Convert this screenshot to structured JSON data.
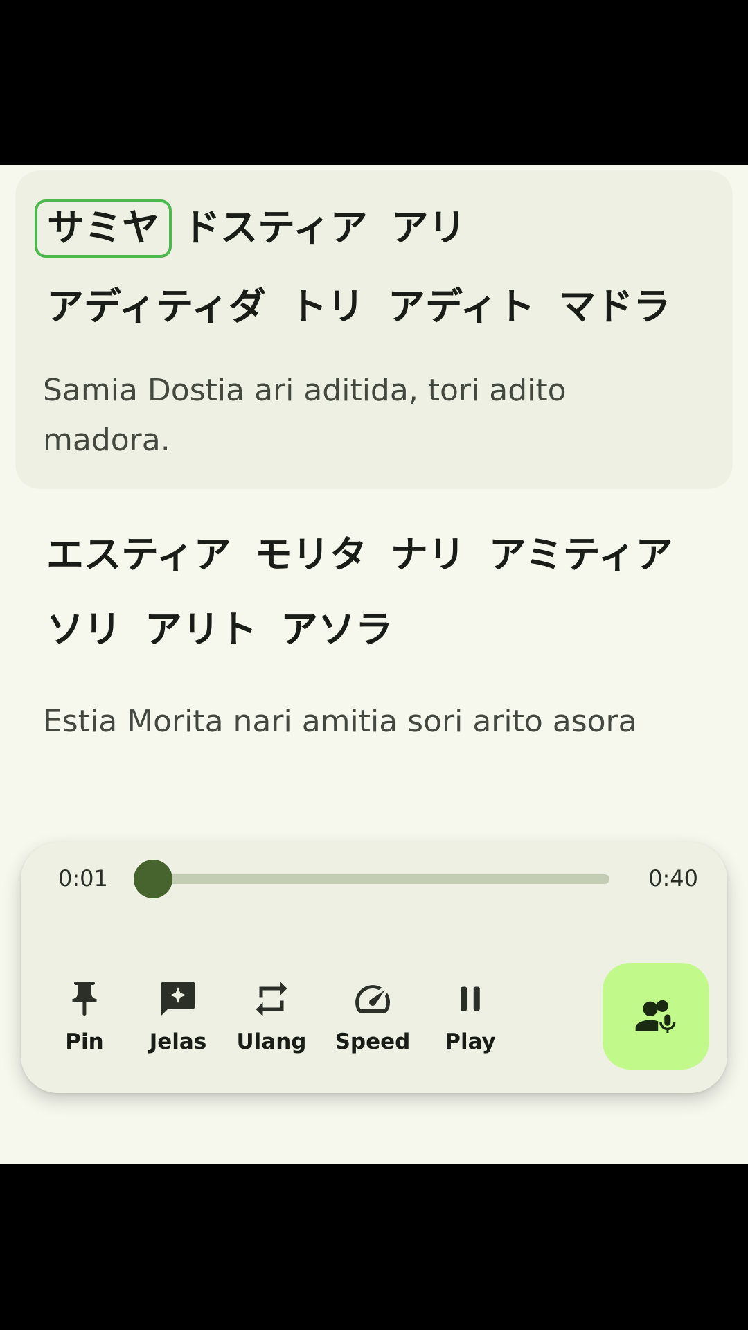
{
  "sentences": [
    {
      "words_line1": [
        "サミヤ",
        "ドスティア",
        "アリ"
      ],
      "words_line2": [
        "アディティダ",
        "トリ",
        "アディト",
        "マドラ"
      ],
      "translation": "Samia Dostia ari aditida, tori adito madora."
    },
    {
      "words_line1": [
        "エスティア",
        "モリタ",
        "ナリ",
        "アミティア"
      ],
      "words_line2": [
        "ソリ",
        "アリト",
        "アソラ"
      ],
      "translation": "Estia Morita nari amitia sori arito asora"
    }
  ],
  "player": {
    "current_time": "0:01",
    "total_time": "0:40",
    "progress_fraction": 0.025,
    "controls": {
      "pin": {
        "label": "Pin",
        "icon": "pin-icon"
      },
      "jelas": {
        "label": "Jelas",
        "icon": "sparkle-comment-icon"
      },
      "ulang": {
        "label": "Ulang",
        "icon": "repeat-icon"
      },
      "speed": {
        "label": "Speed",
        "icon": "speedometer-icon"
      },
      "play": {
        "label": "Play",
        "icon": "pause-icon"
      }
    },
    "fab_icon": "voice-people-icon"
  },
  "colors": {
    "background": "#f6f8ee",
    "card": "#edf0e2",
    "highlight_border": "#4db84d",
    "track": "#c3cdb3",
    "thumb": "#47642f",
    "fab": "#c2f98b"
  }
}
